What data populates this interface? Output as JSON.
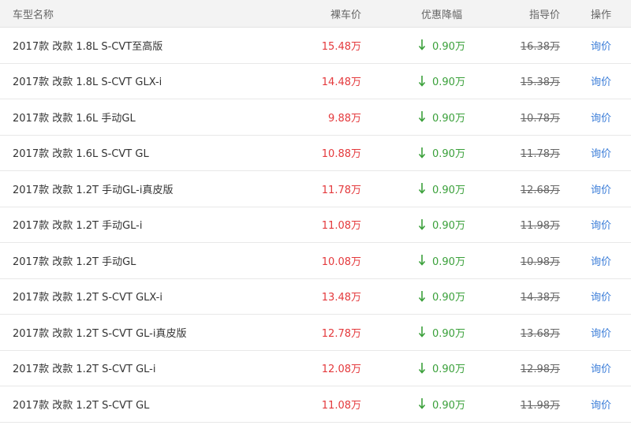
{
  "header": {
    "name": "车型名称",
    "price": "裸车价",
    "discount": "优惠降幅",
    "msrp": "指导价",
    "action": "操作"
  },
  "rows": [
    {
      "name": "2017款 改款 1.8L S-CVT至高版",
      "price": "15.48万",
      "discount": "0.90万",
      "msrp": "16.38万",
      "action": "询价"
    },
    {
      "name": "2017款 改款 1.8L S-CVT GLX-i",
      "price": "14.48万",
      "discount": "0.90万",
      "msrp": "15.38万",
      "action": "询价"
    },
    {
      "name": "2017款 改款 1.6L 手动GL",
      "price": "9.88万",
      "discount": "0.90万",
      "msrp": "10.78万",
      "action": "询价"
    },
    {
      "name": "2017款 改款 1.6L S-CVT GL",
      "price": "10.88万",
      "discount": "0.90万",
      "msrp": "11.78万",
      "action": "询价"
    },
    {
      "name": "2017款 改款 1.2T 手动GL-i真皮版",
      "price": "11.78万",
      "discount": "0.90万",
      "msrp": "12.68万",
      "action": "询价"
    },
    {
      "name": "2017款 改款 1.2T 手动GL-i",
      "price": "11.08万",
      "discount": "0.90万",
      "msrp": "11.98万",
      "action": "询价"
    },
    {
      "name": "2017款 改款 1.2T 手动GL",
      "price": "10.08万",
      "discount": "0.90万",
      "msrp": "10.98万",
      "action": "询价"
    },
    {
      "name": "2017款 改款 1.2T S-CVT GLX-i",
      "price": "13.48万",
      "discount": "0.90万",
      "msrp": "14.38万",
      "action": "询价"
    },
    {
      "name": "2017款 改款 1.2T S-CVT GL-i真皮版",
      "price": "12.78万",
      "discount": "0.90万",
      "msrp": "13.68万",
      "action": "询价"
    },
    {
      "name": "2017款 改款 1.2T S-CVT GL-i",
      "price": "12.08万",
      "discount": "0.90万",
      "msrp": "12.98万",
      "action": "询价"
    },
    {
      "name": "2017款 改款 1.2T S-CVT GL",
      "price": "11.08万",
      "discount": "0.90万",
      "msrp": "11.98万",
      "action": "询价"
    }
  ],
  "colors": {
    "price": "#e4393c",
    "discount": "#3aa03a",
    "link": "#3b7dd8"
  },
  "icons": {
    "discount": "arrow-down-icon"
  }
}
